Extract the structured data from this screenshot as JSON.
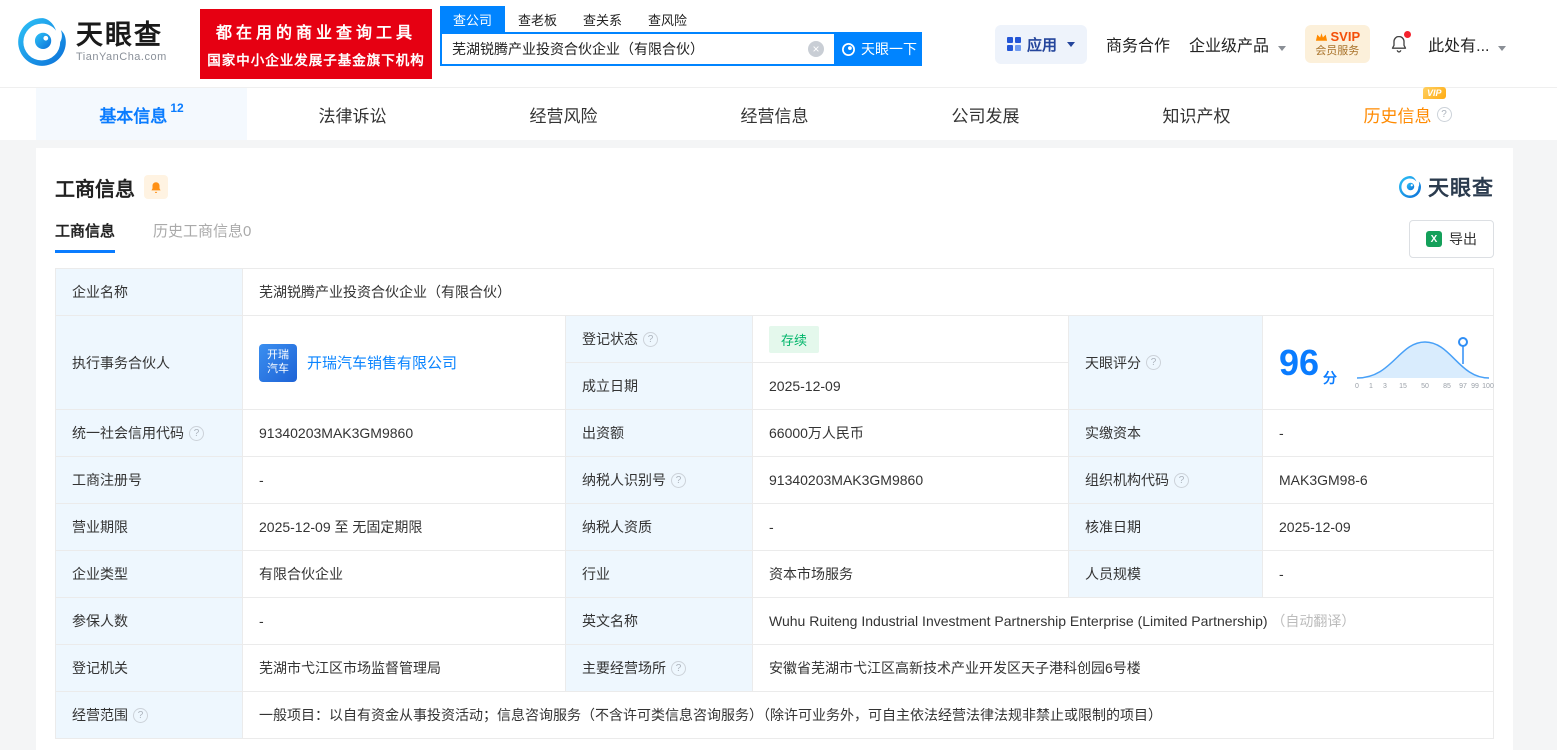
{
  "colors": {
    "brand_blue": "#0084ff",
    "banner_red": "#e60012",
    "status_green": "#00b56a",
    "history_orange": "#ff8a00",
    "label_bg": "#eef7fe"
  },
  "icons": {
    "clear": "×",
    "excel_x": "X",
    "help": "?"
  },
  "header": {
    "logo": {
      "name": "天眼查",
      "domain": "TianYanCha.com"
    },
    "promo": {
      "line1": "都在用的商业查询工具",
      "line2": "国家中小企业发展子基金旗下机构"
    },
    "search_tabs": [
      {
        "label": "查公司"
      },
      {
        "label": "查老板"
      },
      {
        "label": "查关系"
      },
      {
        "label": "查风险"
      }
    ],
    "search": {
      "value": "芜湖锐腾产业投资合伙企业（有限合伙）",
      "button": "天眼一下"
    },
    "apps_label": "应用",
    "links": {
      "cooperation": "商务合作",
      "enterprise": "企业级产品"
    },
    "vip": {
      "top": "SVIP",
      "bottom": "会员服务"
    },
    "user": "此处有..."
  },
  "nav": {
    "tabs": [
      {
        "label": "基本信息",
        "badge": "12"
      },
      {
        "label": "法律诉讼"
      },
      {
        "label": "经营风险"
      },
      {
        "label": "经营信息"
      },
      {
        "label": "公司发展"
      },
      {
        "label": "知识产权"
      },
      {
        "label": "历史信息",
        "vip_tag": "VIP"
      }
    ]
  },
  "business": {
    "title": "工商信息",
    "brand": "天眼查",
    "tabs": [
      {
        "label": "工商信息"
      },
      {
        "label": "历史工商信息0"
      }
    ],
    "export": "导出"
  },
  "info": {
    "company_name": {
      "label": "企业名称",
      "value": "芜湖锐腾产业投资合伙企业（有限合伙）"
    },
    "partner": {
      "label": "执行事务合伙人",
      "logo_line1": "开瑞",
      "logo_line2": "汽车",
      "value": "开瑞汽车销售有限公司"
    },
    "status": {
      "label": "登记状态",
      "value": "存续"
    },
    "established": {
      "label": "成立日期",
      "value": "2025-12-09"
    },
    "score": {
      "label": "天眼评分",
      "value": "96",
      "unit": "分",
      "axis": [
        "0",
        "1",
        "3",
        "15",
        "50",
        "85",
        "97",
        "99",
        "100"
      ]
    },
    "credit_code": {
      "label": "统一社会信用代码",
      "value": "91340203MAK3GM9860"
    },
    "capital": {
      "label": "出资额",
      "value": "66000万人民币"
    },
    "paid_capital": {
      "label": "实缴资本",
      "value": "-"
    },
    "reg_number": {
      "label": "工商注册号",
      "value": "-"
    },
    "taxpayer_id": {
      "label": "纳税人识别号",
      "value": "91340203MAK3GM9860"
    },
    "org_code": {
      "label": "组织机构代码",
      "value": "MAK3GM98-6"
    },
    "business_term": {
      "label": "营业期限",
      "value": "2025-12-09 至 无固定期限"
    },
    "taxpayer_quality": {
      "label": "纳税人资质",
      "value": "-"
    },
    "approval_date": {
      "label": "核准日期",
      "value": "2025-12-09"
    },
    "company_type": {
      "label": "企业类型",
      "value": "有限合伙企业"
    },
    "industry": {
      "label": "行业",
      "value": "资本市场服务"
    },
    "staff_size": {
      "label": "人员规模",
      "value": "-"
    },
    "insured_count": {
      "label": "参保人数",
      "value": "-"
    },
    "english_name": {
      "label": "英文名称",
      "value": "Wuhu Ruiteng Industrial Investment Partnership Enterprise (Limited Partnership)",
      "note": "（自动翻译）"
    },
    "registry": {
      "label": "登记机关",
      "value": "芜湖市弋江区市场监督管理局"
    },
    "address": {
      "label": "主要经营场所",
      "value": "安徽省芜湖市弋江区高新技术产业开发区天子港科创园6号楼"
    },
    "business_scope": {
      "label": "经营范围",
      "value": "一般项目：以自有资金从事投资活动；信息咨询服务（不含许可类信息咨询服务）（除许可业务外，可自主依法经营法律法规非禁止或限制的项目）"
    }
  }
}
